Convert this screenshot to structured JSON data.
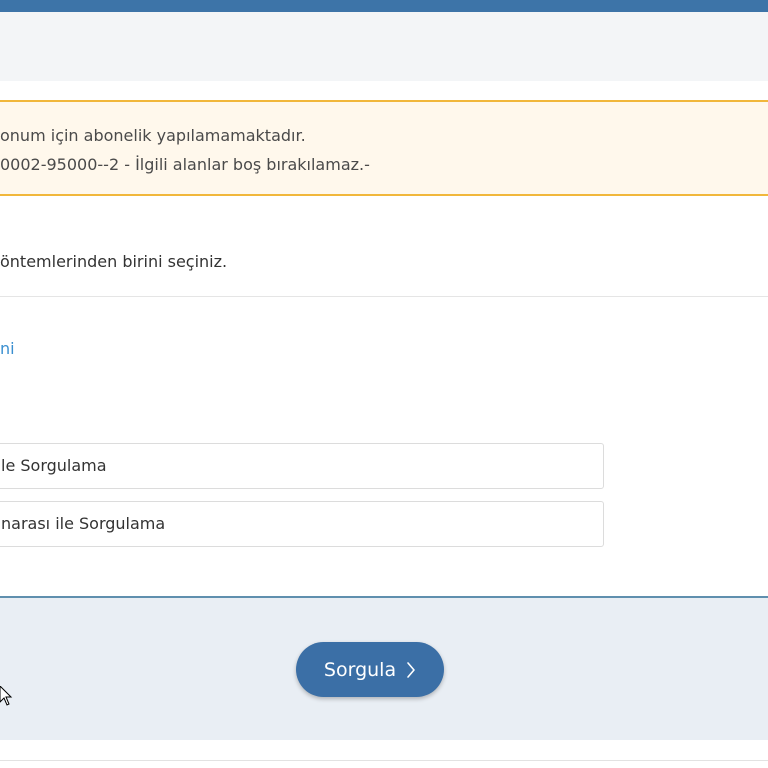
{
  "alert": {
    "line1": "onum için abonelik yapılamamaktadır.",
    "line2": "0002-95000--2 - İlgili alanlar boş bırakılamaz.-"
  },
  "instruction": "öntemlerinden birini seçiniz.",
  "link_text": "ni",
  "options": [
    "le Sorgulama",
    "narası ile Sorgulama"
  ],
  "query_button": {
    "label": "Sorgula",
    "icon": "chevron-right-icon"
  },
  "colors": {
    "top_bar": "#3d74a8",
    "alert_border": "#f1b73b",
    "alert_bg": "#fff8ec",
    "link": "#3a8fd0",
    "button_bg": "#3b6fa6",
    "footer_bg": "#e9eef4"
  }
}
